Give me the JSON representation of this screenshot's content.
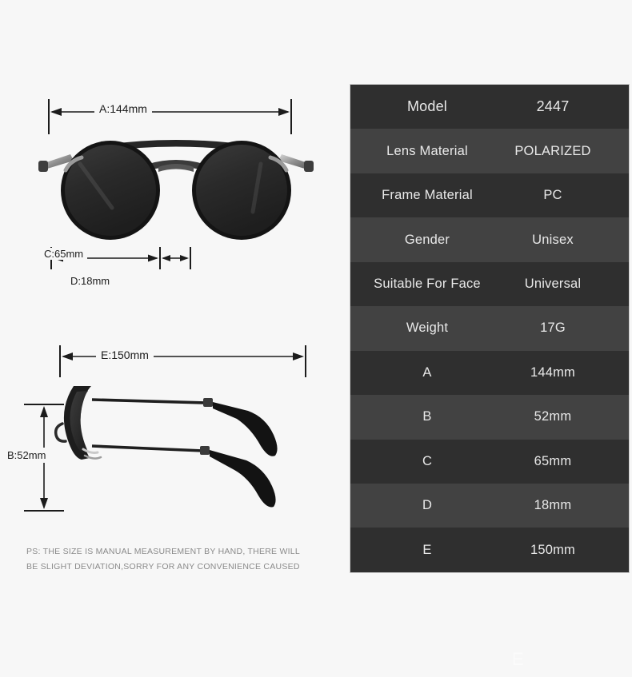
{
  "background_color": "#f7f7f7",
  "table": {
    "row_color_dark": "#2f2f2f",
    "row_color_light": "#424242",
    "text_color": "#e9e9e9",
    "rows": [
      {
        "label": "Model",
        "value": "2447"
      },
      {
        "label": "Lens Material",
        "value": "POLARIZED"
      },
      {
        "label": "Frame Material",
        "value": "PC"
      },
      {
        "label": "Gender",
        "value": "Unisex"
      },
      {
        "label": "Suitable For Face",
        "value": "Universal"
      },
      {
        "label": "Weight",
        "value": "17G"
      },
      {
        "label": "A",
        "value": "144mm"
      },
      {
        "label": "B",
        "value": "52mm"
      },
      {
        "label": "C",
        "value": "65mm"
      },
      {
        "label": "D",
        "value": "18mm"
      },
      {
        "label": "E",
        "value": "150mm"
      }
    ]
  },
  "diagrams": {
    "front_view": {
      "dimension_a": "A:144mm",
      "dimension_c": "C:65mm",
      "dimension_d": "D:18mm"
    },
    "side_view": {
      "dimension_e": "E:150mm",
      "dimension_b": "B:52mm"
    }
  },
  "footnote": {
    "line1": "PS: THE SIZE IS MANUAL MEASUREMENT BY HAND, THERE WILL",
    "line2": "BE SLIGHT DEVIATION,SORRY FOR ANY CONVENIENCE CAUSED"
  },
  "watermark": {
    "text": "E"
  }
}
